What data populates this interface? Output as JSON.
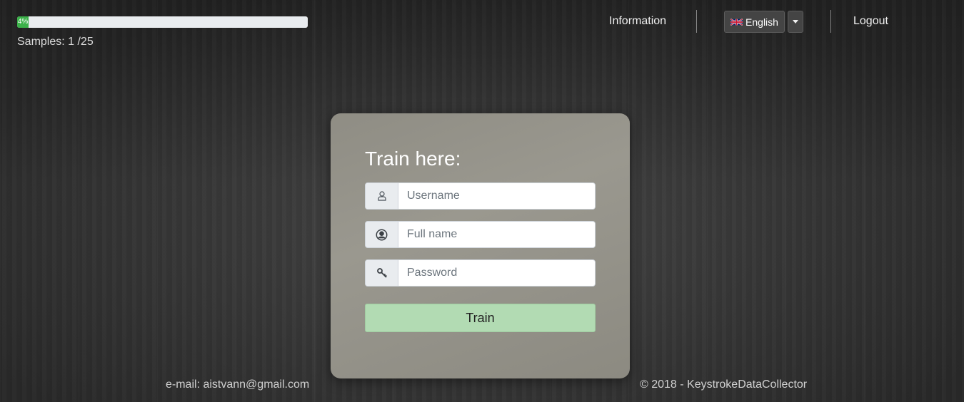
{
  "progress": {
    "label": "4%",
    "percent": 4
  },
  "samples": {
    "text": "Samples: 1 /25"
  },
  "nav": {
    "information": "Information",
    "language": "English",
    "logout": "Logout"
  },
  "card": {
    "title": "Train here:",
    "username_placeholder": "Username",
    "fullname_placeholder": "Full name",
    "password_placeholder": "Password",
    "train_label": "Train"
  },
  "footer": {
    "email": "e-mail: aistvann@gmail.com",
    "copyright": "© 2018 - KeystrokeDataCollector"
  },
  "colors": {
    "progress_fill": "#3cb14a",
    "train_button": "#b2dbb3",
    "card_bg": "#95938a"
  },
  "icons": {
    "username": "user-icon",
    "fullname": "user-circle-icon",
    "password": "key-icon",
    "language": "uk-flag-icon",
    "dropdown": "caret-down-icon"
  }
}
